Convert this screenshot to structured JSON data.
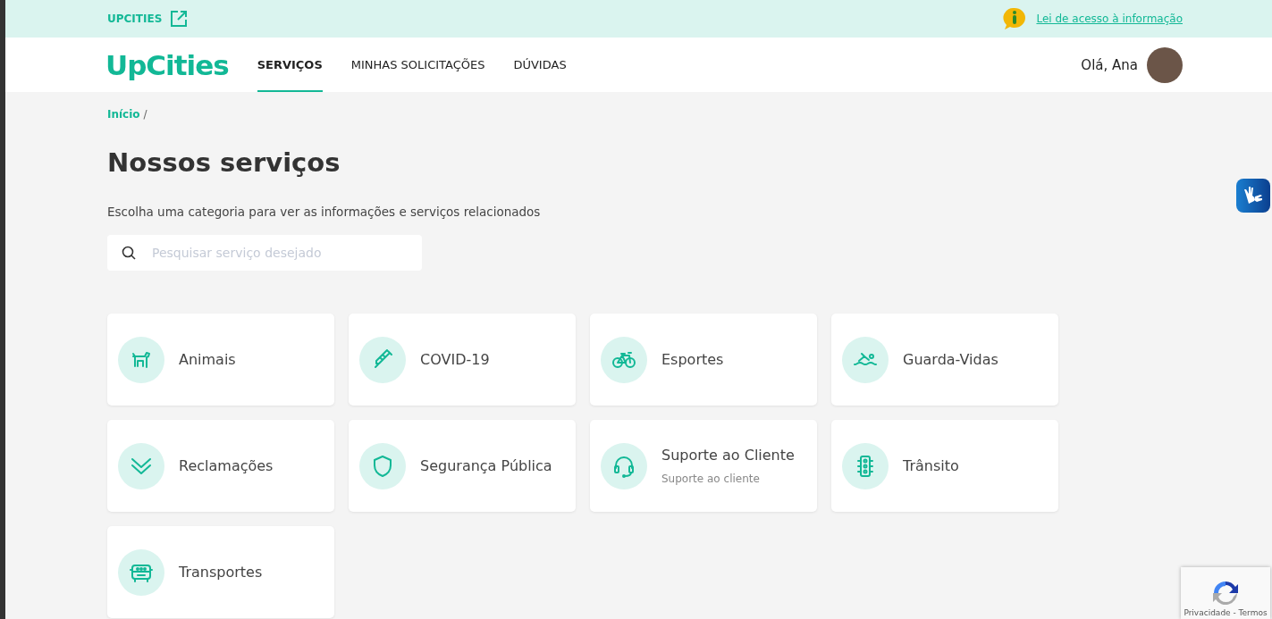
{
  "top_bar": {
    "brand_link": "UPCITIES",
    "info_link": "Lei de acesso à informação"
  },
  "nav": {
    "logo": "UpCities",
    "tabs": [
      {
        "label": "SERVIÇOS",
        "selected": true
      },
      {
        "label": "MINHAS SOLICITAÇÕES",
        "selected": false
      },
      {
        "label": "DÚVIDAS",
        "selected": false
      }
    ],
    "greeting": "Olá, Ana"
  },
  "breadcrumb": {
    "link": "Início",
    "separator": "/"
  },
  "title": "Nossos serviços",
  "subtitle": "Escolha uma categoria para ver as informações e serviços relacionados",
  "search": {
    "placeholder": "Pesquisar serviço desejado"
  },
  "categories": [
    {
      "name": "Animais"
    },
    {
      "name": "COVID-19"
    },
    {
      "name": "Esportes"
    },
    {
      "name": "Guarda-Vidas"
    },
    {
      "name": "Reclamações"
    },
    {
      "name": "Segurança Pública"
    },
    {
      "name": "Suporte ao Cliente",
      "description": "Suporte ao cliente"
    },
    {
      "name": "Trânsito"
    },
    {
      "name": "Transportes"
    }
  ],
  "recaptcha": {
    "links": "Privacidade - Termos"
  }
}
